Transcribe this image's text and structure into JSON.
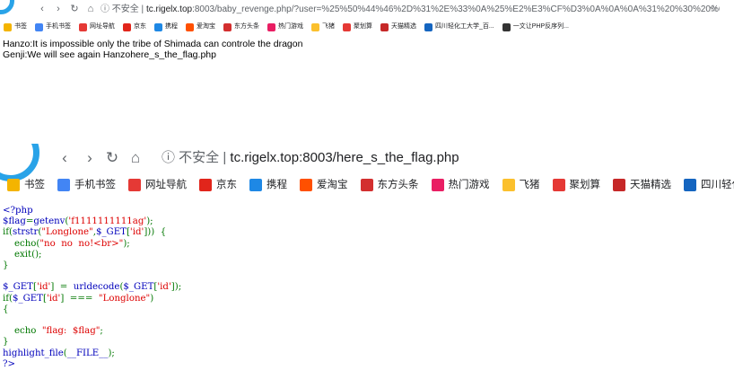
{
  "top": {
    "url_security": "不安全",
    "url_host": "tc.rigelx.top",
    "url_rest": ":8003/baby_revenge.php/?user=%25%50%44%46%2D%31%2E%33%0A%25%E2%E3%CF%D3%0A%0A%0A%31%20%30%20%6F%62%6A%0A%3...",
    "bookmarks": [
      {
        "icon": "star-icon",
        "label": "书签",
        "color": "#f4b400"
      },
      {
        "icon": "phone-bookmark-icon",
        "label": "手机书签",
        "color": "#4285f4"
      },
      {
        "icon": "site-nav-icon",
        "label": "网址导航",
        "color": "#e53935"
      },
      {
        "icon": "jd-icon",
        "label": "京东",
        "color": "#e1251b"
      },
      {
        "icon": "ctrip-icon",
        "label": "携程",
        "color": "#1e88e5"
      },
      {
        "icon": "taobao-icon",
        "label": "爱淘宝",
        "color": "#ff5000"
      },
      {
        "icon": "eastday-icon",
        "label": "东方头条",
        "color": "#d32f2f"
      },
      {
        "icon": "game-icon",
        "label": "热门游戏",
        "color": "#e91e63"
      },
      {
        "icon": "fliggy-icon",
        "label": "飞猪",
        "color": "#fbc02d"
      },
      {
        "icon": "juhuasuan-icon",
        "label": "聚划算",
        "color": "#e53935"
      },
      {
        "icon": "tmall-icon",
        "label": "天猫精选",
        "color": "#c62828"
      },
      {
        "icon": "paw-icon",
        "label": "四川轻化工大学_百...",
        "color": "#1565c0"
      },
      {
        "icon": "article-icon",
        "label": "一文让PHP反序列...",
        "color": "#333333"
      }
    ],
    "page_lines": [
      "Hanzo:It is impossible only the tribe of Shimada can controle the dragon",
      "Genji:We will see again Hanzohere_s_the_flag.php"
    ]
  },
  "bottom": {
    "url_security": "不安全",
    "url_host": "tc.rigelx.top",
    "url_rest": ":8003/here_s_the_flag.php",
    "bookmarks": [
      {
        "icon": "star-icon",
        "label": "书签",
        "color": "#f4b400"
      },
      {
        "icon": "phone-bookmark-icon",
        "label": "手机书签",
        "color": "#4285f4"
      },
      {
        "icon": "site-nav-icon",
        "label": "网址导航",
        "color": "#e53935"
      },
      {
        "icon": "jd-icon",
        "label": "京东",
        "color": "#e1251b"
      },
      {
        "icon": "ctrip-icon",
        "label": "携程",
        "color": "#1e88e5"
      },
      {
        "icon": "taobao-icon",
        "label": "爱淘宝",
        "color": "#ff5000"
      },
      {
        "icon": "eastday-icon",
        "label": "东方头条",
        "color": "#d32f2f"
      },
      {
        "icon": "game-icon",
        "label": "热门游戏",
        "color": "#e91e63"
      },
      {
        "icon": "fliggy-icon",
        "label": "飞猪",
        "color": "#fbc02d"
      },
      {
        "icon": "juhuasuan-icon",
        "label": "聚划算",
        "color": "#e53935"
      },
      {
        "icon": "tmall-icon",
        "label": "天猫精选",
        "color": "#c62828"
      },
      {
        "icon": "paw-icon",
        "label": "四川轻化工",
        "color": "#1565c0"
      }
    ],
    "code": {
      "l1": "<?php",
      "l2a": "$flag",
      "l2b": "=",
      "l2c": "getenv",
      "l2d": "(",
      "l2e": "'f1111111111ag'",
      "l2f": ");",
      "l3a": "if(",
      "l3b": "strstr",
      "l3c": "(",
      "l3d": "\"Longlone\"",
      "l3e": ",",
      "l3f": "$_GET",
      "l3g": "[",
      "l3h": "'id'",
      "l3i": "]))  {",
      "l4a": "    echo(",
      "l4b": "\"no  no  no!<br>\"",
      "l4c": ");",
      "l5a": "    ",
      "l5b": "exit",
      "l5c": "();",
      "l6": "}",
      "l8a": "$_GET",
      "l8b": "[",
      "l8c": "'id'",
      "l8d": "]  =  ",
      "l8e": "urldecode",
      "l8f": "(",
      "l8g": "$_GET",
      "l8h": "[",
      "l8i": "'id'",
      "l8j": "]);",
      "l9a": "if(",
      "l9b": "$_GET",
      "l9c": "[",
      "l9d": "'id'",
      "l9e": "]  ===  ",
      "l9f": "\"Longlone\"",
      "l9g": ")",
      "l10": "{",
      "l12a": "    echo  ",
      "l12b": "\"flag:  $flag\"",
      "l12c": ";",
      "l13": "}",
      "l14a": "highlight_file",
      "l14b": "(",
      "l14c": "__FILE__",
      "l14d": ");",
      "l15": "?>"
    }
  }
}
